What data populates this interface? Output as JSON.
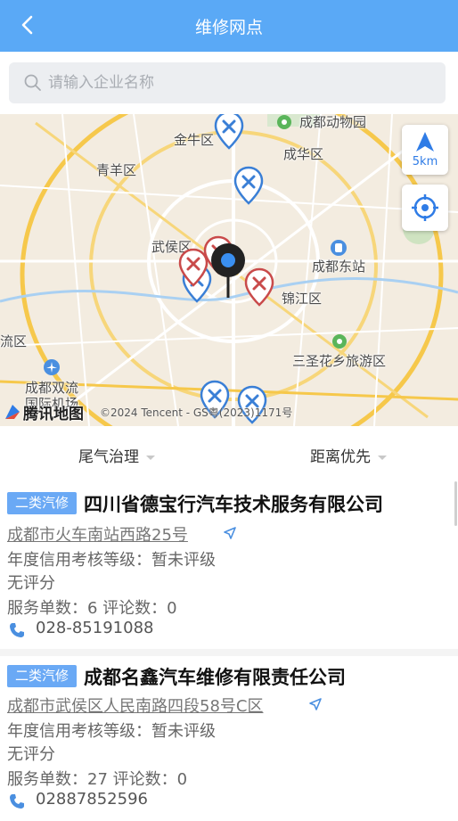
{
  "header": {
    "title": "维修网点",
    "back_icon": "chevron-left-icon"
  },
  "search": {
    "placeholder": "请输入企业名称",
    "value": "",
    "icon": "search-icon"
  },
  "map": {
    "labels": {
      "chengdu_zoo": "成都动物园",
      "jinniu": "金牛区",
      "chenghua": "成华区",
      "qingyang": "青羊区",
      "wuhou": "武侯区",
      "east_station": "成都东站",
      "jinjiang": "锦江区",
      "liu": "流区",
      "sansheng": "三圣花乡旅游区",
      "shuangliu1": "成都双流",
      "shuangliu2": "国际机场"
    },
    "scale": "5km",
    "logo": "腾讯地图",
    "copyright": "©2024 Tencent - GS粤(2023)1171号",
    "accent": "#2f7ce6"
  },
  "filters": {
    "category": "尾气治理",
    "sort": "距离优先"
  },
  "shops": [
    {
      "badge": "二类汽修",
      "name": "四川省德宝行汽车技术服务有限公司",
      "address": "成都市火车南站西路25号",
      "credit": "年度信用考核等级：暂未评级",
      "rating": "无评分",
      "stats": "服务单数：6  评论数：0",
      "phone": "028-85191088"
    },
    {
      "badge": "二类汽修",
      "name": "成都名鑫汽车维修有限责任公司",
      "address": "成都市武侯区人民南路四段58号C区",
      "credit": "年度信用考核等级：暂未评级",
      "rating": "无评分",
      "stats": "服务单数：27  评论数：0",
      "phone": "02887852596"
    }
  ],
  "colors": {
    "header": "#5aa9f6",
    "badge": "#6aa9f5",
    "pin_blue": "#3a7fd6",
    "pin_red": "#c94a4a"
  }
}
